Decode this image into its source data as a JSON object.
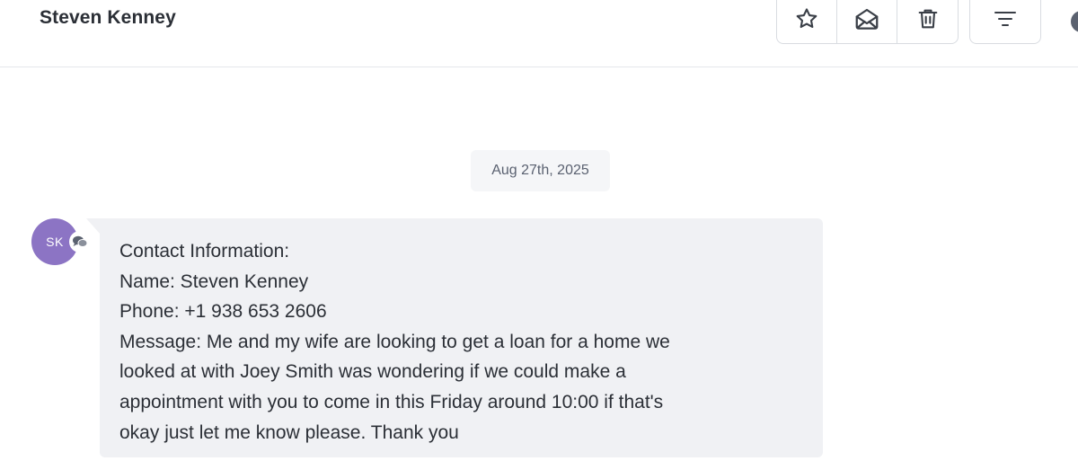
{
  "header": {
    "contact_name": "Steven Kenney",
    "actions": [
      {
        "name": "star",
        "icon": "star-icon"
      },
      {
        "name": "mark-read",
        "icon": "envelope-open-icon"
      },
      {
        "name": "delete",
        "icon": "trash-icon"
      }
    ],
    "filter_icon": "filter-lines-icon"
  },
  "conversation": {
    "date_divider": "Aug 27th, 2025",
    "message": {
      "avatar_initials": "SK",
      "avatar_color": "#8c74c4",
      "channel_icon": "chat-bubbles-icon",
      "lines": [
        "Contact Information:",
        "Name: Steven Kenney",
        "Phone: +1 938 653 2606",
        "Message: Me and my wife are looking to get a loan for a home we",
        "looked at with Joey Smith was wondering if we could make a",
        "appointment with you to come in this Friday around 10:00 if that's",
        "okay just let me know please. Thank you"
      ]
    }
  }
}
